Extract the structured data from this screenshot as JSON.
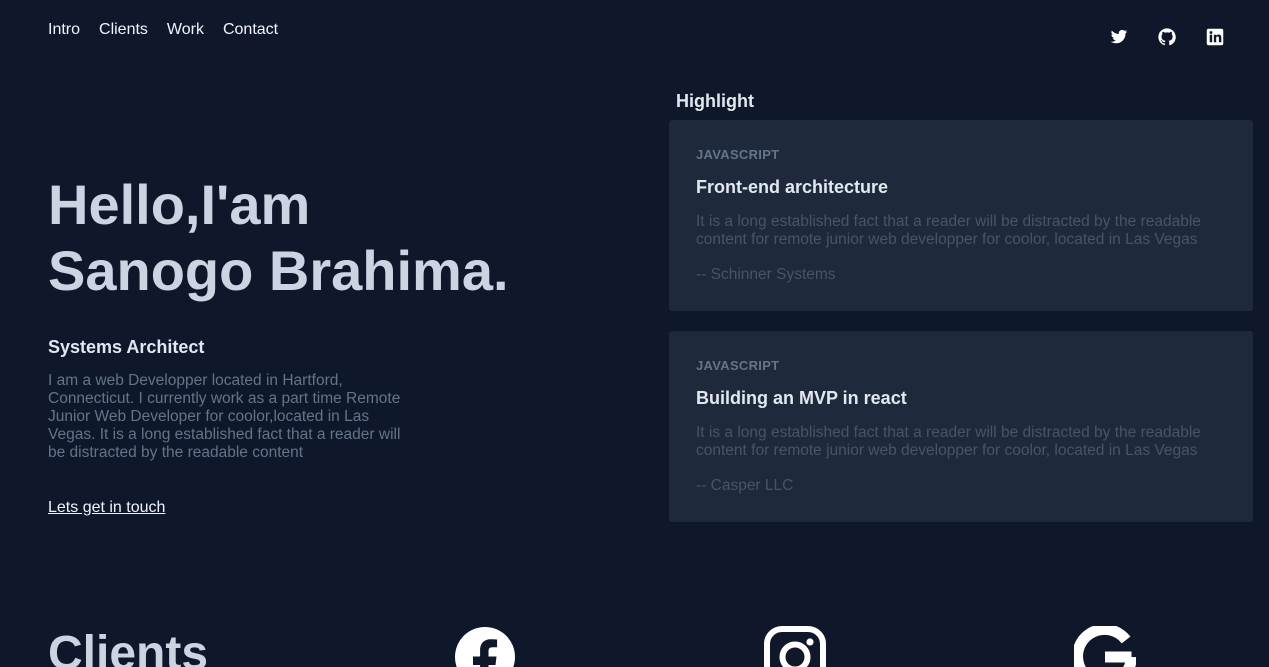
{
  "nav": {
    "items": [
      {
        "label": "Intro"
      },
      {
        "label": "Clients"
      },
      {
        "label": "Work"
      },
      {
        "label": "Contact"
      }
    ]
  },
  "social": {
    "icons": [
      "twitter-icon",
      "github-icon",
      "linkedin-icon"
    ]
  },
  "hero": {
    "title_line1": "Hello,I'am",
    "title_line2": "Sanogo Brahima.",
    "role": "Systems Architect",
    "bio": "I am a web Developper located in Hartford, Connecticut. I currently work as a part time Remote Junior Web Developer for coolor,located in Las Vegas. It is a long established fact that a reader will be distracted by the readable content",
    "cta": "Lets get in touch"
  },
  "highlight": {
    "heading": "Highlight",
    "cards": [
      {
        "tag": "JAVASCRIPT",
        "title": "Front-end architecture",
        "text": "It is a long established fact that a reader will be distracted by the readable content for remote junior web developper for coolor, located in Las Vegas",
        "author": "-- Schinner Systems"
      },
      {
        "tag": "JAVASCRIPT",
        "title": "Building an MVP in react",
        "text": "It is a long established fact that a reader will be distracted by the readable content for remote junior web developper for coolor, located in Las Vegas",
        "author": "-- Casper LLC"
      }
    ]
  },
  "clients": {
    "title": "Clients",
    "logos": [
      "facebook-icon",
      "instagram-icon",
      "google-icon"
    ]
  },
  "colors": {
    "background": "#0f172a",
    "card": "#1e293b",
    "heading": "#cbd5e1",
    "muted": "#64748b"
  }
}
